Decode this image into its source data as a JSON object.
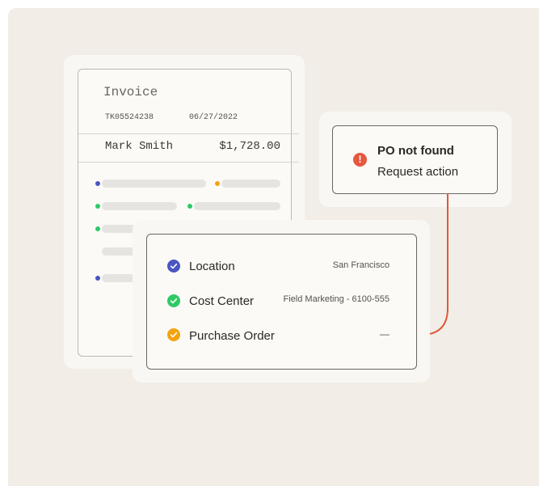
{
  "invoice": {
    "title": "Invoice",
    "number": "TK05524238",
    "date": "06/27/2022",
    "customer": "Mark Smith",
    "amount": "$1,728.00"
  },
  "alert": {
    "title": "PO not found",
    "subtitle": "Request action"
  },
  "details": {
    "rows": [
      {
        "label": "Location",
        "value": "San Francisco",
        "icon": "check-icon",
        "color": "#4a55c2"
      },
      {
        "label": "Cost Center",
        "value": "Field Marketing - 6100-555",
        "icon": "check-icon",
        "color": "#2fc966"
      },
      {
        "label": "Purchase Order",
        "value": "—",
        "icon": "check-icon",
        "color": "#f2a30f"
      }
    ]
  },
  "colors": {
    "background": "#f2eee7",
    "connector": "#e2573b",
    "alert_icon": "#e5573f",
    "placeholder_blue": "#4a55c2",
    "placeholder_green": "#2fc966",
    "placeholder_yellow": "#f2a30f"
  }
}
